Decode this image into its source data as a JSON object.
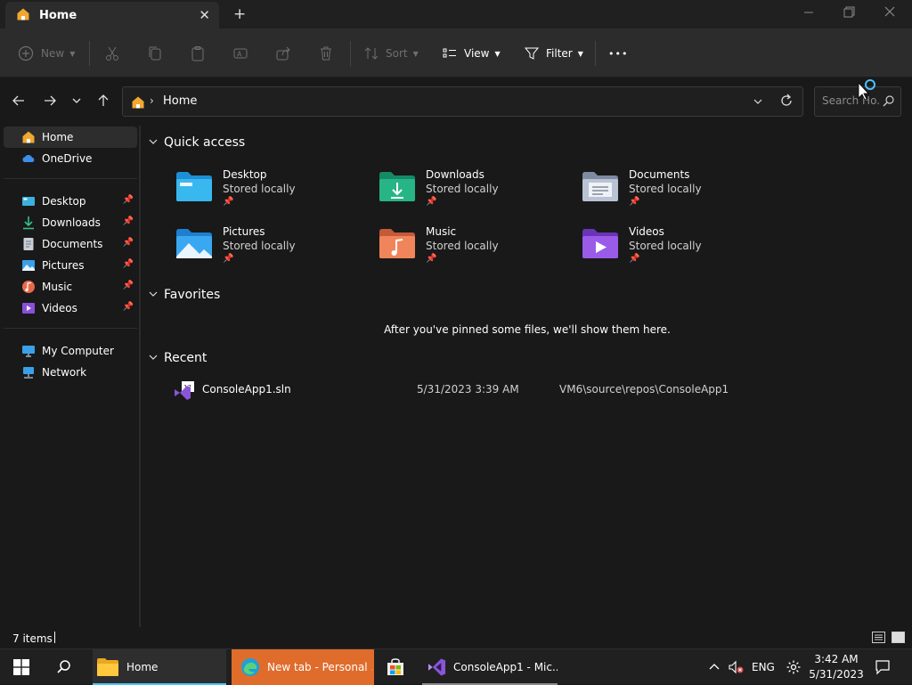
{
  "window": {
    "tab_title": "Home",
    "tab_close": "✕",
    "new_tab": "+"
  },
  "commandbar": {
    "new_label": "New",
    "sort_label": "Sort",
    "view_label": "View",
    "filter_label": "Filter",
    "more_label": "•••"
  },
  "address": {
    "crumb": "Home",
    "search_placeholder": "Search Ho..."
  },
  "sidebar": {
    "items": [
      {
        "label": "Home",
        "icon": "home-icon",
        "selected": true
      },
      {
        "label": "OneDrive",
        "icon": "onedrive-icon"
      },
      {
        "label": "Desktop",
        "icon": "desktop-icon",
        "pinned": true
      },
      {
        "label": "Downloads",
        "icon": "downloads-icon",
        "pinned": true
      },
      {
        "label": "Documents",
        "icon": "documents-icon",
        "pinned": true
      },
      {
        "label": "Pictures",
        "icon": "pictures-icon",
        "pinned": true
      },
      {
        "label": "Music",
        "icon": "music-icon",
        "pinned": true
      },
      {
        "label": "Videos",
        "icon": "videos-icon",
        "pinned": true
      },
      {
        "label": "My Computer",
        "icon": "computer-icon"
      },
      {
        "label": "Network",
        "icon": "network-icon"
      }
    ]
  },
  "main": {
    "quick_access_title": "Quick access",
    "quick_access": [
      {
        "name": "Desktop",
        "status": "Stored locally",
        "icon": "desktop-folder-icon"
      },
      {
        "name": "Downloads",
        "status": "Stored locally",
        "icon": "downloads-folder-icon"
      },
      {
        "name": "Documents",
        "status": "Stored locally",
        "icon": "documents-folder-icon"
      },
      {
        "name": "Pictures",
        "status": "Stored locally",
        "icon": "pictures-folder-icon"
      },
      {
        "name": "Music",
        "status": "Stored locally",
        "icon": "music-folder-icon"
      },
      {
        "name": "Videos",
        "status": "Stored locally",
        "icon": "videos-folder-icon"
      }
    ],
    "favorites_title": "Favorites",
    "favorites_empty": "After you've pinned some files, we'll show them here.",
    "recent_title": "Recent",
    "recent": [
      {
        "name": "ConsoleApp1.sln",
        "date": "5/31/2023 3:39 AM",
        "path": "VM6\\source\\repos\\ConsoleApp1"
      }
    ]
  },
  "status": {
    "count": "7 items"
  },
  "taskbar": {
    "apps": [
      {
        "label": "Home",
        "icon": "file-explorer-icon"
      },
      {
        "label": "New tab - Personal ...",
        "icon": "edge-icon"
      },
      {
        "label": "",
        "icon": "store-icon"
      },
      {
        "label": "ConsoleApp1 - Mic...",
        "icon": "visual-studio-icon"
      }
    ],
    "language": "ENG",
    "time": "3:42 AM",
    "date": "5/31/2023"
  },
  "colors": {
    "accent": "#4cc2ff",
    "background": "#191919",
    "chrome": "#2c2c2c",
    "edge_active": "#e06c2c"
  }
}
